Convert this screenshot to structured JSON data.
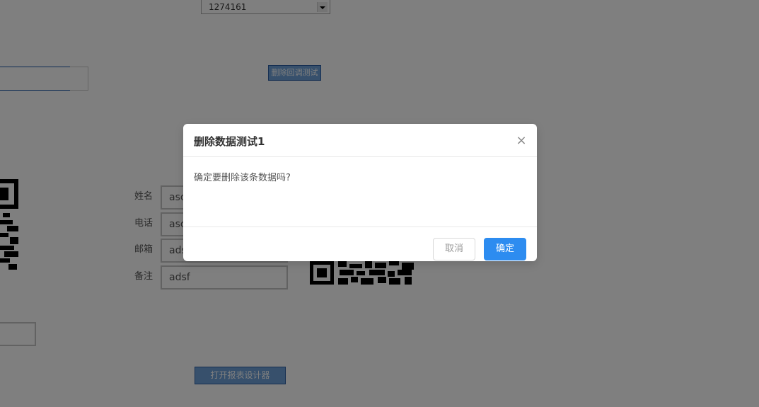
{
  "page": {
    "select_value": "1274161",
    "delete_callback_button": "删除回调测试",
    "report_button": "打开报表设计器"
  },
  "form": {
    "fields": [
      {
        "label": "姓名",
        "value": "asc"
      },
      {
        "label": "电话",
        "value": "asc"
      },
      {
        "label": "邮箱",
        "value": "ads"
      },
      {
        "label": "备注",
        "value": "adsf"
      }
    ]
  },
  "modal": {
    "title": "删除数据测试1",
    "close_glyph": "×",
    "message": "确定要删除该条数据吗?",
    "cancel_label": "取消",
    "ok_label": "确定"
  },
  "colors": {
    "primary": "#2d8cf0",
    "overlay": "rgba(0,0,0,0.5)",
    "legacy_button": "#6fa1d8"
  }
}
